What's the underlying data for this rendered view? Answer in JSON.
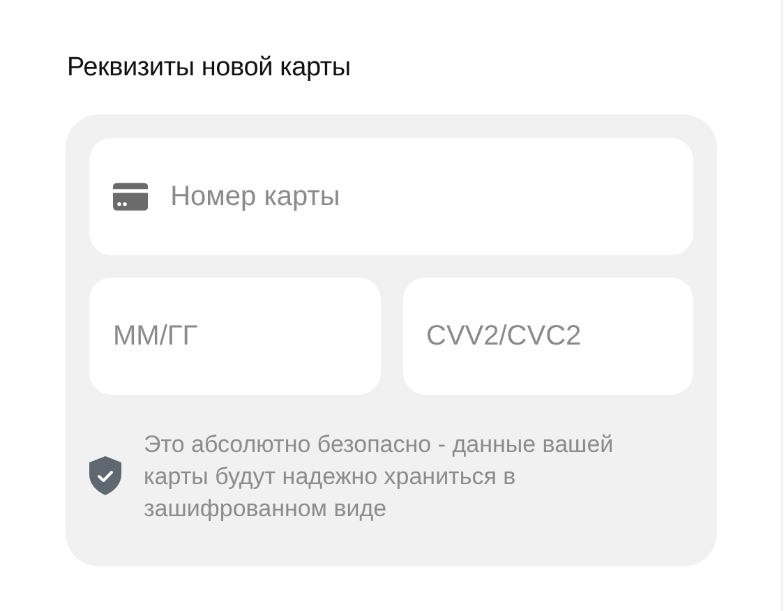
{
  "title": "Реквизиты новой карты",
  "card_number": {
    "placeholder": "Номер карты"
  },
  "expiry": {
    "placeholder": "ММ/ГГ"
  },
  "cvv": {
    "placeholder": "CVV2/CVC2"
  },
  "security_note": "Это абсолютно безопасно - данные вашей карты будут надежно храниться в зашифрованном виде"
}
